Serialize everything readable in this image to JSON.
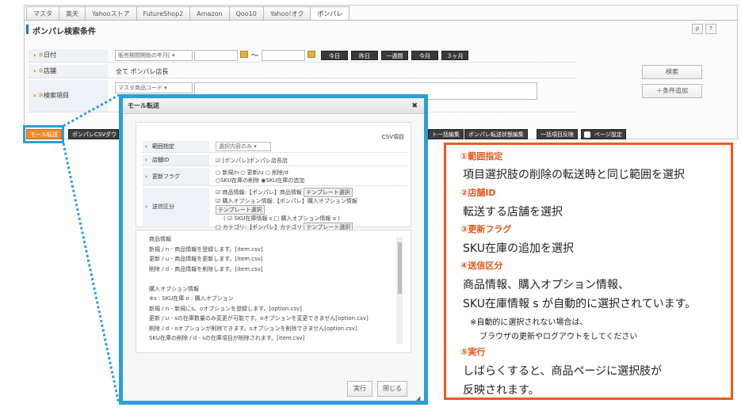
{
  "tabs": [
    "マスタ",
    "楽天",
    "Yahooストア",
    "FutureShop2",
    "Amazon",
    "Qoo10",
    "Yahoo!オク",
    "ポンパレ"
  ],
  "section_title": "ポンパレ検索条件",
  "title_buttons": {
    "search": "ρ",
    "help": "?"
  },
  "rows": {
    "date": {
      "label": "日付",
      "mark": "※",
      "select": "販売期間開始の年月[ ▾",
      "tilde": "～"
    },
    "date_buttons": [
      "今日",
      "昨日",
      "一週間",
      "今月",
      "３ヶ月"
    ],
    "store": {
      "label": "店舗",
      "mark": "※",
      "value": "全て ポンパレ店長"
    },
    "keyword": {
      "label": "検索項目",
      "mark": "※",
      "select": "マスタ商品コード ▾"
    }
  },
  "side_buttons": {
    "search": "検索",
    "add_condition": "＋条件追加"
  },
  "toolbar": {
    "mall_transfer": "モール転送",
    "csv_download": "ポンパレCSVダウ",
    "bulk_edit": "ト一括編集",
    "status_edit": "ポンパレ転送状態編集",
    "bulk_apply": "一括項目反映",
    "page_settings": "ページ設定"
  },
  "modal": {
    "title": "モール転送",
    "close": "✖",
    "csv_label": "CSV項目",
    "range": {
      "label": "範囲指定",
      "select": "選択内容のみ ▾"
    },
    "shop": {
      "label": "店舗ID",
      "value": "[ポンパレ]ポンパレ店長店"
    },
    "flag": {
      "label": "更新フラグ",
      "line1": "○ 新規/n ○ 更新/u ○ 削除/d",
      "line2": "○SKU在庫の削除 ◉SKU在庫の追加"
    },
    "send": {
      "label": "送信区分",
      "line1": "☑ 商品情報:【ポンパレ】商品情報",
      "line2": "☑ 購入オプション情報:【ポンパレ】購入オプション情報",
      "line3": "( ☑ SKU在庫情報 s □ 購入オプション情報 o )",
      "line4": "□ カテゴリ:【ポンパレ】カテゴリ",
      "template": "テンプレート選択"
    },
    "text_lines": [
      "商品情報",
      "新規 / n - 商品情報を登録します。[item.csv]",
      "更新 / u - 商品情報を更新します。[item.csv]",
      "削除 / d - 商品情報を削除します。[item.csv]",
      "",
      "購入オプション情報",
      "※s : SKU在庫 o : 購入オプション",
      "新規 / n - 新規にs、oオプションを登録します。[option.csv]",
      "更新 / u - sの在庫数量のみ変更が可能です。oオプションを変更できません[option.csv]",
      "削除 / d - oオプションが削除できます。sオプションを削除できません[option.csv]",
      "SKU在庫の削除 / d - sの在庫項目が削除されます。[item.csv]"
    ],
    "run": "実行",
    "close_btn": "閉じる"
  },
  "callout": {
    "h1": "①範囲指定",
    "t1": "項目選択肢の削除の転送時と同じ範囲を選択",
    "h2": "②店舗ID",
    "t2": "転送する店舗を選択",
    "h3": "③更新フラグ",
    "t3": "SKU在庫の追加を選択",
    "h4": "④送信区分",
    "t4a": "商品情報、購入オプション情報、",
    "t4b": "SKU在庫情報 s が自動的に選択されています。",
    "note1": "※自動的に選択されない場合は、",
    "note2": "ブラウザの更新やログアウトをしてください",
    "h5": "⑤実行",
    "t5a": "しばらくすると、商品ページに選択肢が",
    "t5b": "反映されます。"
  },
  "colors": {
    "accent": "#2a9fd8",
    "callout": "#ee5a1b",
    "orange_btn": "#f08a2c"
  }
}
